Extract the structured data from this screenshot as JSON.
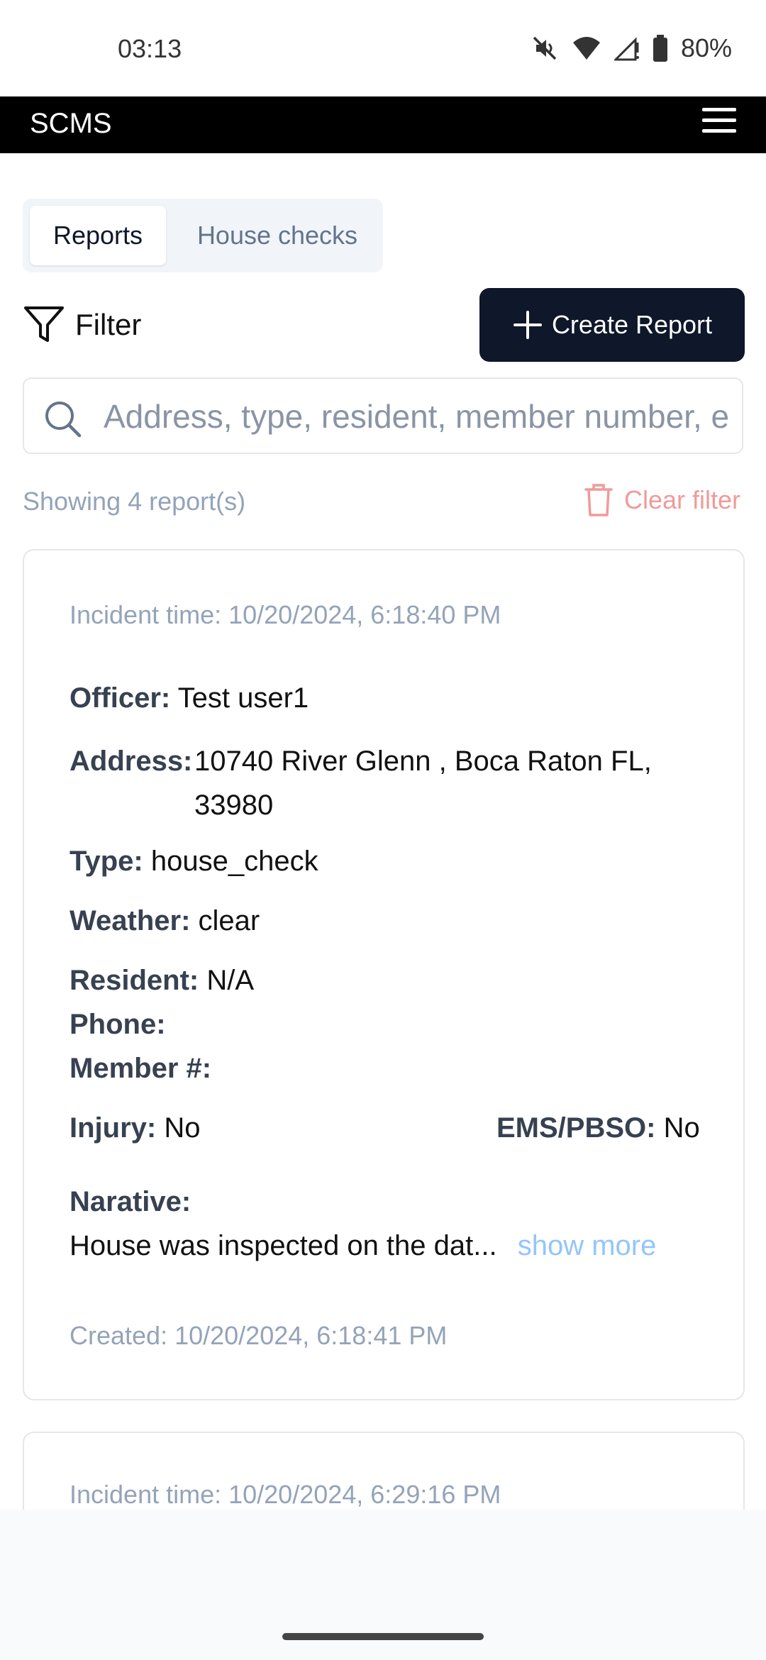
{
  "status_bar": {
    "time": "03:13",
    "battery": "80%"
  },
  "app": {
    "title": "SCMS"
  },
  "tabs": [
    {
      "label": "Reports",
      "active": true
    },
    {
      "label": "House checks",
      "active": false
    }
  ],
  "toolbar": {
    "filter_label": "Filter",
    "create_label": "Create Report"
  },
  "search": {
    "placeholder": "Address, type, resident, member number, e"
  },
  "summary": {
    "showing": "Showing 4 report(s)",
    "clear_filter": "Clear filter"
  },
  "reports": [
    {
      "incident_time": "Incident time: 10/20/2024, 6:18:40 PM",
      "officer_label": "Officer:",
      "officer": "Test user1",
      "address_label": "Address:",
      "address": "10740 River Glenn , Boca Raton FL, 33980",
      "type_label": "Type:",
      "type": "house_check",
      "weather_label": "Weather:",
      "weather": "clear",
      "resident_label": "Resident:",
      "resident": "N/A",
      "phone_label": "Phone:",
      "phone": "",
      "member_label": "Member #:",
      "member": "",
      "injury_label": "Injury:",
      "injury": "No",
      "ems_label": "EMS/PBSO:",
      "ems": "No",
      "narrative_label": "Narative:",
      "narrative": "House was inspected on the dat...",
      "show_more": "show more",
      "created": "Created: 10/20/2024, 6:18:41 PM"
    },
    {
      "incident_time": "Incident time: 10/20/2024, 6:29:16 PM"
    }
  ],
  "colors": {
    "primary": "#0f172a",
    "appbar": "#000000",
    "danger_light": "#f19a9a",
    "link": "#93c5fd",
    "muted": "#94a3b8"
  },
  "icons": [
    "mute-icon",
    "wifi-icon",
    "signal-icon",
    "battery-icon",
    "menu-icon",
    "filter-icon",
    "plus-icon",
    "search-icon",
    "trash-icon"
  ]
}
